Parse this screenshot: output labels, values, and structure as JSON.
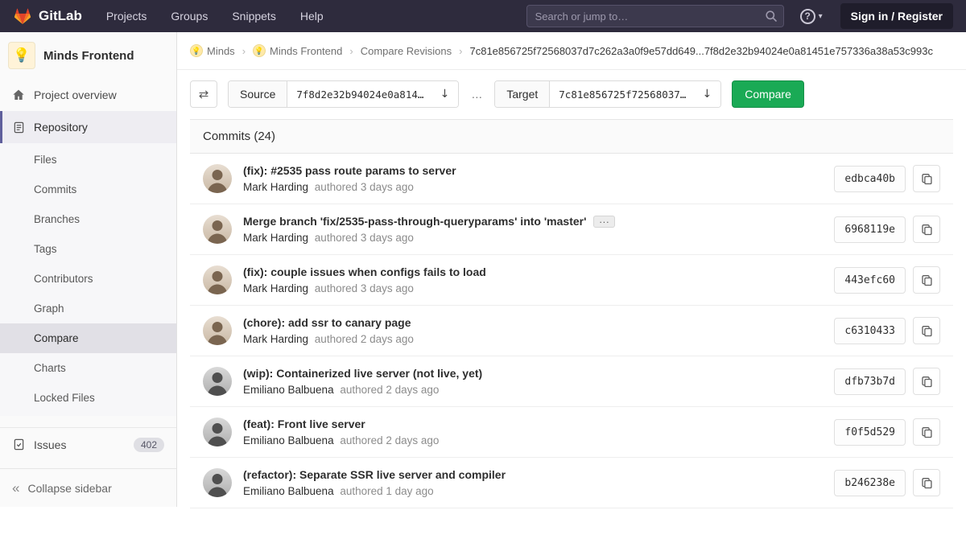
{
  "navbar": {
    "brand": "GitLab",
    "links": [
      "Projects",
      "Groups",
      "Snippets",
      "Help"
    ],
    "search_placeholder": "Search or jump to…",
    "sign_in": "Sign in / Register"
  },
  "sidebar": {
    "project": {
      "name": "Minds Frontend",
      "avatar": "💡"
    },
    "overview": "Project overview",
    "repository": {
      "label": "Repository",
      "items": [
        "Files",
        "Commits",
        "Branches",
        "Tags",
        "Contributors",
        "Graph",
        "Compare",
        "Charts",
        "Locked Files"
      ],
      "active_item": "Compare"
    },
    "issues": {
      "label": "Issues",
      "count": "402"
    },
    "collapse": "Collapse sidebar"
  },
  "breadcrumb": {
    "group": "Minds",
    "project": "Minds Frontend",
    "page": "Compare Revisions",
    "current": "7c81e856725f72568037d7c262a3a0f9e57dd649...7f8d2e32b94024e0a81451e757336a38a53c993c"
  },
  "compare_form": {
    "source_label": "Source",
    "source_value": "7f8d2e32b94024e0a814…",
    "separator": "…",
    "target_label": "Target",
    "target_value": "7c81e856725f72568037…",
    "compare_button": "Compare",
    "swap_icon": "⇄",
    "download_icon": "↓"
  },
  "commits": {
    "header": "Commits (24)",
    "expander_label": "...",
    "items": [
      {
        "title": "(fix): #2535 pass route params to server",
        "author": "Mark Harding",
        "meta": "authored 3 days ago",
        "hash": "edbca40b"
      },
      {
        "title": "Merge branch 'fix/2535-pass-through-queryparams' into 'master'",
        "author": "Mark Harding",
        "meta": "authored 3 days ago",
        "hash": "6968119e"
      },
      {
        "title": "(fix): couple issues when configs fails to load",
        "author": "Mark Harding",
        "meta": "authored 3 days ago",
        "hash": "443efc60"
      },
      {
        "title": "(chore): add ssr to canary page",
        "author": "Mark Harding",
        "meta": "authored 2 days ago",
        "hash": "c6310433"
      },
      {
        "title": "(wip): Containerized live server (not live, yet)",
        "author": "Emiliano Balbuena",
        "meta": "authored 2 days ago",
        "hash": "dfb73b7d"
      },
      {
        "title": "(feat): Front live server",
        "author": "Emiliano Balbuena",
        "meta": "authored 2 days ago",
        "hash": "f0f5d529"
      },
      {
        "title": "(refactor): Separate SSR live server and compiler",
        "author": "Emiliano Balbuena",
        "meta": "authored 1 day ago",
        "hash": "b246238e"
      }
    ]
  }
}
